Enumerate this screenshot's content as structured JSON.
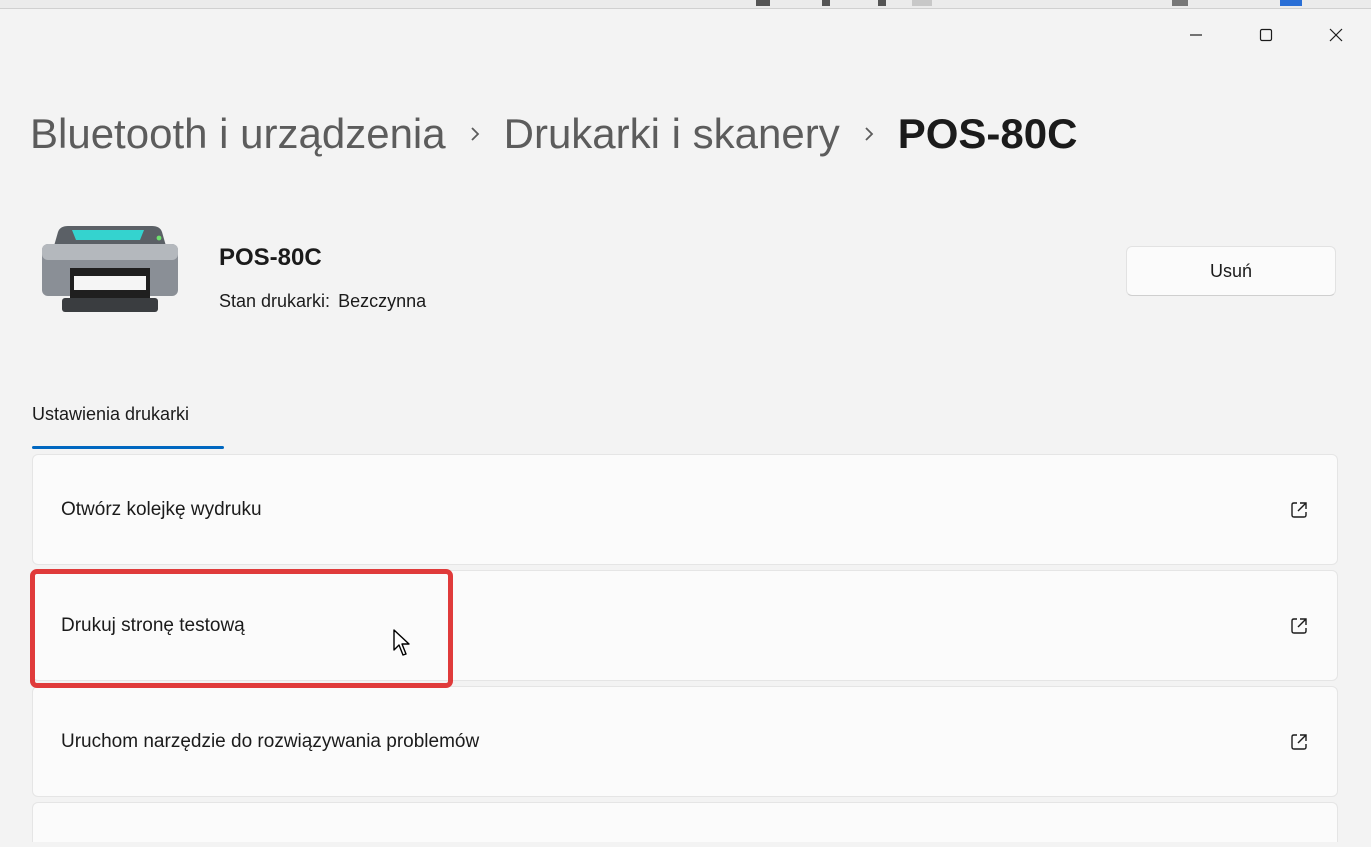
{
  "breadcrumb": {
    "items": [
      "Bluetooth i urządzenia",
      "Drukarki i skanery"
    ],
    "current": "POS-80C"
  },
  "device": {
    "name": "POS-80C",
    "status_label": "Stan drukarki:",
    "status_value": "Bezczynna",
    "icon": "printer-icon"
  },
  "actions": {
    "remove_label": "Usuń"
  },
  "tabs": [
    {
      "label": "Ustawienia drukarki",
      "selected": true
    }
  ],
  "settings_list": [
    {
      "label": "Otwórz kolejkę wydruku",
      "icon": "open-external-icon"
    },
    {
      "label": "Drukuj stronę testową",
      "icon": "open-external-icon",
      "highlighted": true
    },
    {
      "label": "Uruchom narzędzie do rozwiązywania problemów",
      "icon": "open-external-icon"
    }
  ],
  "colors": {
    "accent": "#0067c0",
    "highlight": "#e03b3b",
    "background": "#f3f3f3",
    "card": "#fbfbfb"
  }
}
